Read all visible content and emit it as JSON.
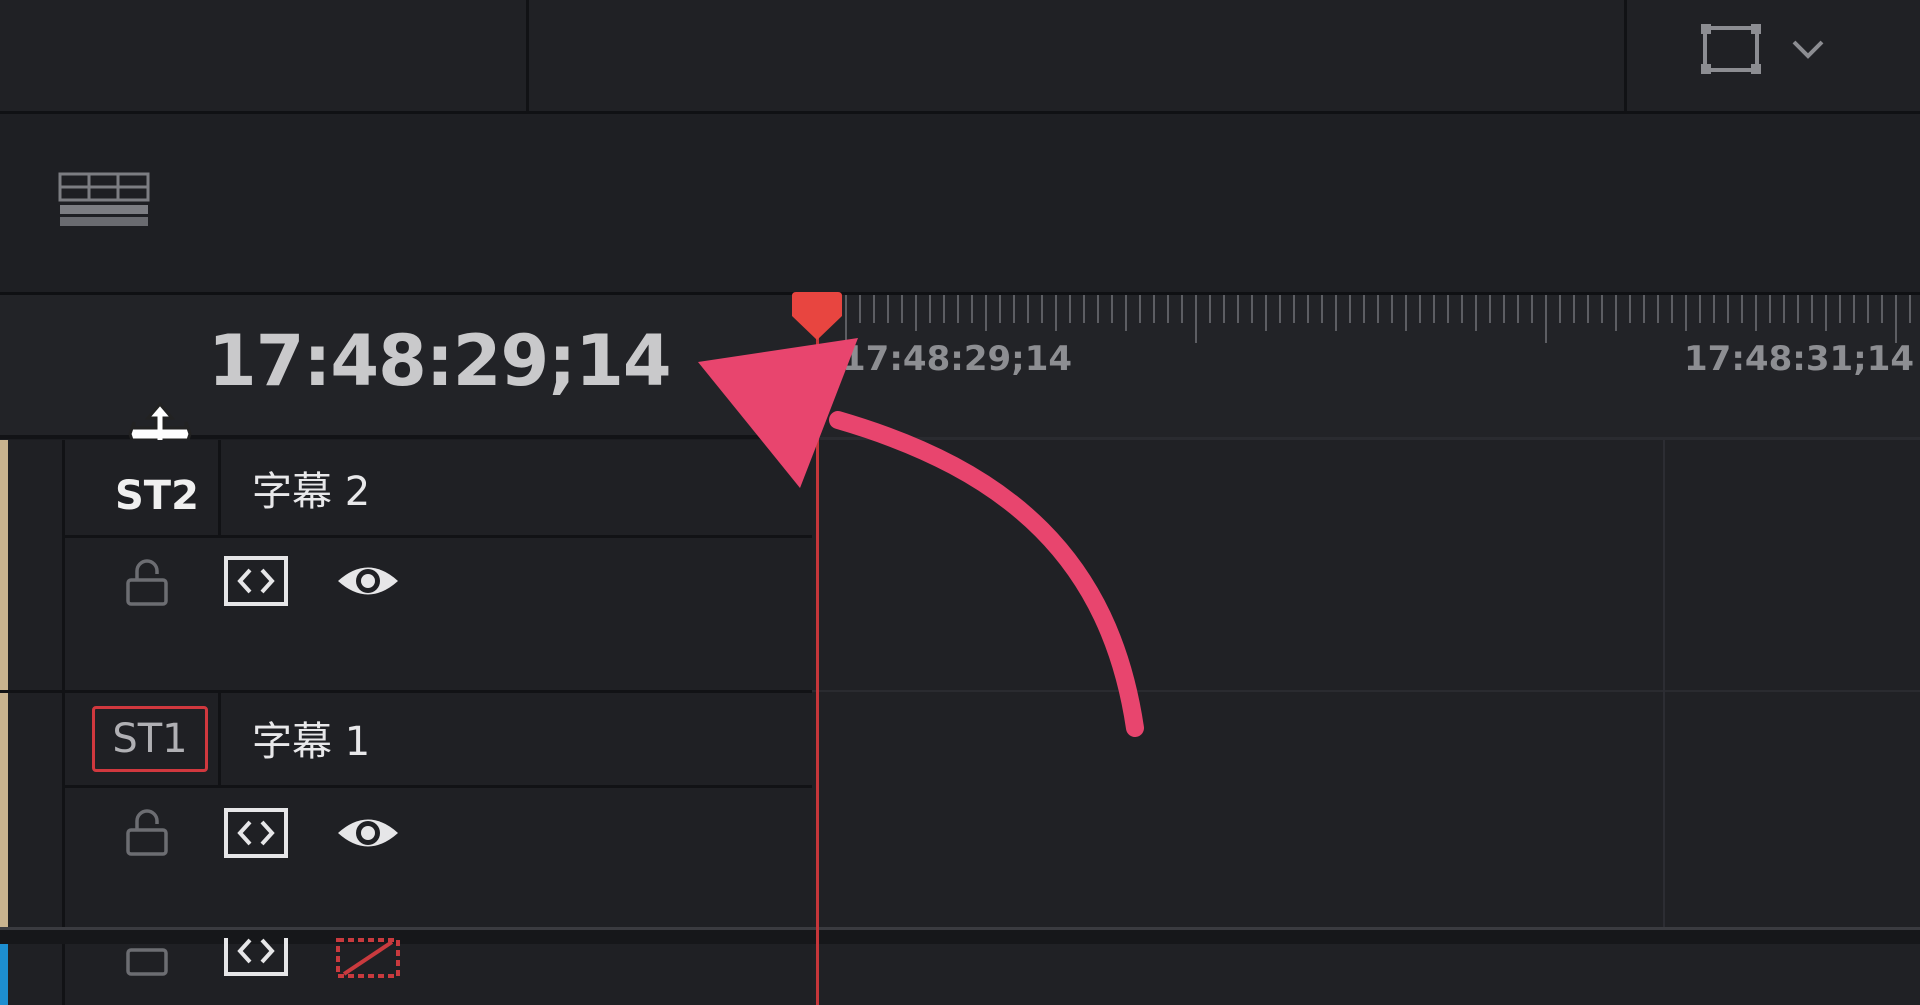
{
  "timecode": {
    "current": "17:48:29;14"
  },
  "ruler": {
    "labels": [
      "17:48:29;14",
      "17:48:31;14"
    ]
  },
  "tracks": [
    {
      "code": "ST2",
      "name": "字幕 2",
      "color": "#c8b38f",
      "enabled": true
    },
    {
      "code": "ST1",
      "name": "字幕 1",
      "color": "#c8b38f",
      "enabled": true
    }
  ],
  "colors": {
    "playhead": "#e84540",
    "annotation_arrow": "#e8456e",
    "bottom_track": "#1d8fd1"
  },
  "icons": {
    "viewer_mode": "frame-icon",
    "viewer_dropdown": "chevron-down-icon",
    "layout_toggle": "timeline-layout-icon",
    "lock": "lock-icon",
    "auto_select": "auto-select-icon",
    "visibility": "eye-icon",
    "disabled_track": "track-disabled-icon"
  }
}
